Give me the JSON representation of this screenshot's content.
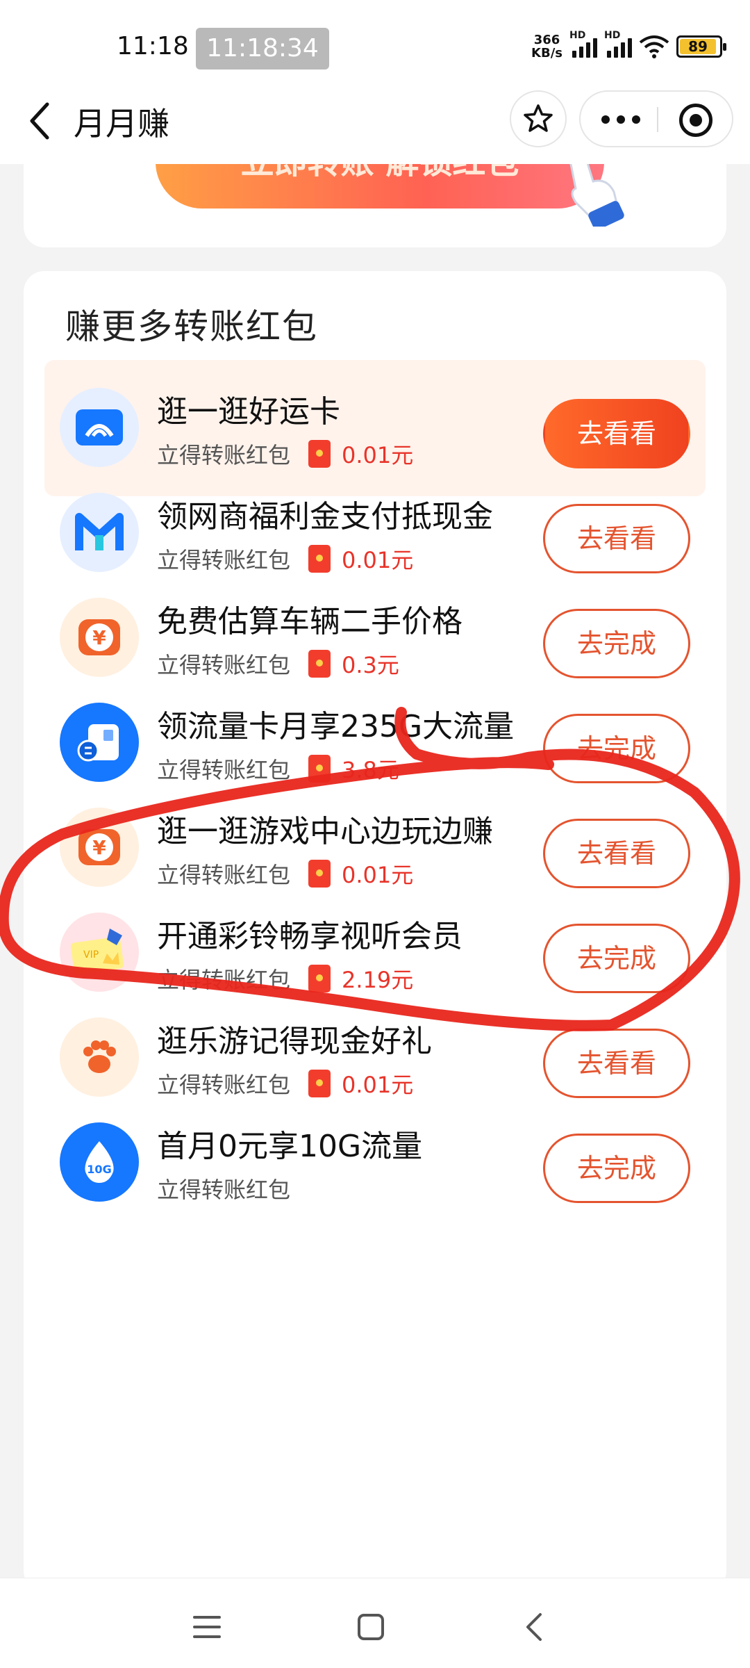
{
  "status_bar": {
    "time": "11:18",
    "time_pill": "11:18:34",
    "net_speed_value": "366",
    "net_speed_unit": "KB/s",
    "hd_label": "HD",
    "battery": "89"
  },
  "header": {
    "title": "月月赚"
  },
  "banner": {
    "text": "立即转账 解锁红包"
  },
  "section": {
    "title": "赚更多转账红包"
  },
  "tasks": [
    {
      "name": "逛一逛好运卡",
      "sub": "立得转账红包",
      "reward": "0.01元",
      "button": "去看看",
      "icon": "wifi-card-icon",
      "icon_bg": "#e6efff",
      "highlight": true
    },
    {
      "name": "领网商福利金支付抵现金",
      "sub": "立得转账红包",
      "reward": "0.01元",
      "button": "去看看",
      "icon": "mybank-logo-icon",
      "icon_bg": "#e6efff",
      "highlight": false
    },
    {
      "name": "免费估算车辆二手价格",
      "sub": "立得转账红包",
      "reward": "0.3元",
      "button": "去完成",
      "icon": "yuan-coin-icon",
      "icon_bg": "#fff0e0",
      "highlight": false
    },
    {
      "name": "领流量卡月享235G大流量",
      "sub": "立得转账红包",
      "reward": "3.8元",
      "button": "去完成",
      "icon": "sim-card-icon",
      "icon_bg": "#1677ff",
      "highlight": false
    },
    {
      "name": "逛一逛游戏中心边玩边赚",
      "sub": "立得转账红包",
      "reward": "0.01元",
      "button": "去看看",
      "icon": "yuan-coin-icon",
      "icon_bg": "#fff0e0",
      "highlight": false
    },
    {
      "name": "开通彩铃畅享视听会员",
      "sub": "立得转账红包",
      "reward": "2.19元",
      "button": "去完成",
      "icon": "vip-card-icon",
      "icon_bg": "#ffe3e6",
      "highlight": false
    },
    {
      "name": "逛乐游记得现金好礼",
      "sub": "立得转账红包",
      "reward": "0.01元",
      "button": "去看看",
      "icon": "paw-icon",
      "icon_bg": "#fff0e0",
      "highlight": false
    },
    {
      "name": "首月0元享10G流量",
      "sub": "立得转账红包",
      "reward": "",
      "button": "去完成",
      "icon": "data-drop-icon",
      "icon_bg": "#1677ff",
      "highlight": false
    }
  ],
  "colors": {
    "accent": "#e4542f",
    "reward": "#e8342a",
    "scribble": "#e8261c"
  }
}
